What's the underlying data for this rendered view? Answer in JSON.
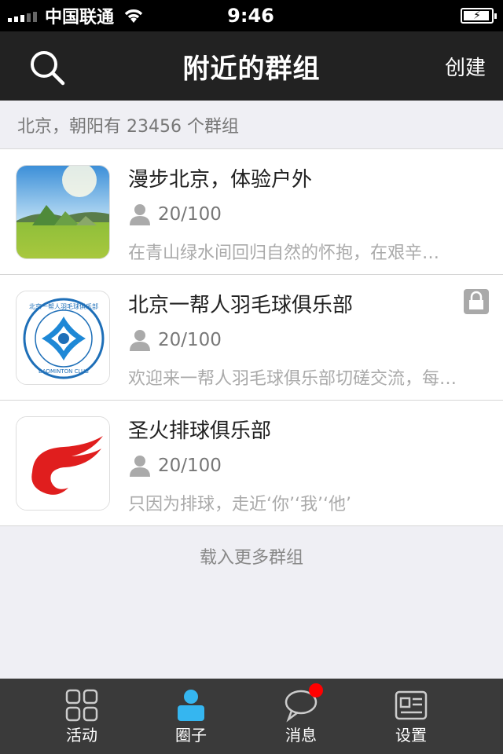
{
  "status_bar": {
    "carrier": "中国联通",
    "time": "9:46"
  },
  "nav": {
    "title": "附近的群组",
    "create_label": "创建"
  },
  "location_header": "北京，朝阳有 23456 个群组",
  "groups": [
    {
      "name": "漫步北京，体验户外",
      "members": "20/100",
      "description": "在青山绿水间回归自然的怀抱，在艰辛…",
      "locked": false
    },
    {
      "name": "北京一帮人羽毛球俱乐部",
      "members": "20/100",
      "description": "欢迎来一帮人羽毛球俱乐部切磋交流，每…",
      "locked": true,
      "logo_text": "北京一帮人羽毛球俱乐部 BADMINTON CLUB"
    },
    {
      "name": "圣火排球俱乐部",
      "members": "20/100",
      "description": "只因为排球，走近‘你’‘我’‘他’",
      "locked": false
    }
  ],
  "load_more": "载入更多群组",
  "tabs": [
    {
      "label": "活动",
      "icon": "grid-icon",
      "active": false
    },
    {
      "label": "圈子",
      "icon": "person-icon",
      "active": true
    },
    {
      "label": "消息",
      "icon": "chat-bubble-icon",
      "active": false,
      "badge": true
    },
    {
      "label": "设置",
      "icon": "profile-card-icon",
      "active": false
    }
  ],
  "colors": {
    "nav_bg": "#222222",
    "tab_bg": "#3a3a3a",
    "active_tab": "#35b6f0",
    "badge": "#ff0000",
    "page_bg": "#efeff4"
  }
}
